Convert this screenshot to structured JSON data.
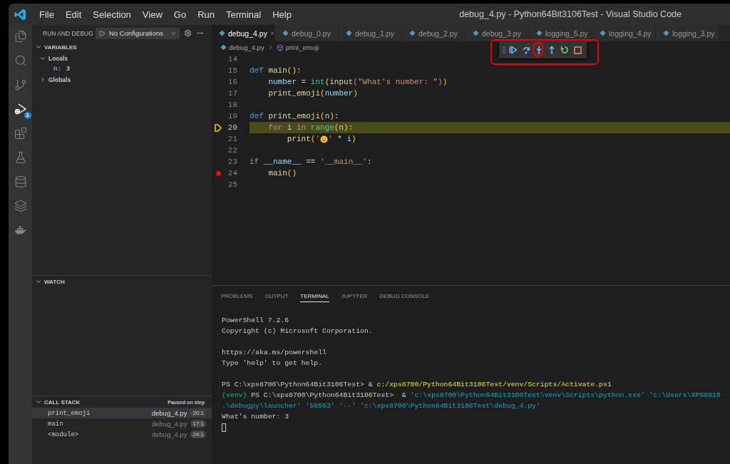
{
  "window": {
    "title": "debug_4.py - Python64Bit3106Test - Visual Studio Code"
  },
  "menu": [
    "File",
    "Edit",
    "Selection",
    "View",
    "Go",
    "Run",
    "Terminal",
    "Help"
  ],
  "activity_bar": [
    {
      "kind": "explorer",
      "selected": false
    },
    {
      "kind": "search",
      "selected": false
    },
    {
      "kind": "source-control",
      "selected": false
    },
    {
      "kind": "run-debug",
      "selected": true,
      "badge": "1"
    },
    {
      "kind": "extensions",
      "selected": false
    },
    {
      "kind": "testing",
      "selected": false
    },
    {
      "kind": "database",
      "selected": false
    },
    {
      "kind": "layers",
      "selected": false
    },
    {
      "kind": "docker",
      "selected": false
    }
  ],
  "sidebar": {
    "title": "RUN AND DEBUG",
    "configuration": "No Configurations",
    "variables": {
      "title": "VARIABLES",
      "expanded": true,
      "scopes": [
        {
          "name": "Locals",
          "expanded": true,
          "children": [
            {
              "name": "n:",
              "value": "3"
            }
          ]
        },
        {
          "name": "Globals",
          "expanded": false
        }
      ]
    },
    "watch": {
      "title": "WATCH",
      "expanded": true
    },
    "call_stack": {
      "title": "CALL STACK",
      "status": "Paused on step",
      "expanded": true,
      "frames": [
        {
          "name": "print_emoji",
          "file": "debug_4.py",
          "position": "20:1",
          "selected": true
        },
        {
          "name": "main",
          "file": "debug_4.py",
          "position": "17:1",
          "selected": false
        },
        {
          "name": "<module>",
          "file": "debug_4.py",
          "position": "24:1",
          "selected": false
        }
      ]
    }
  },
  "tabs": [
    {
      "label": "debug_4.py",
      "selected": true
    },
    {
      "label": "debug_0.py",
      "selected": false
    },
    {
      "label": "debug_1.py",
      "selected": false
    },
    {
      "label": "debug_2.py",
      "selected": false
    },
    {
      "label": "debug_3.py",
      "selected": false
    },
    {
      "label": "logging_5.py",
      "selected": false
    },
    {
      "label": "logging_4.py",
      "selected": false
    },
    {
      "label": "logging_3.py",
      "selected": false
    }
  ],
  "breadcrumb": [
    "debug_4.py",
    "print_emoji"
  ],
  "debug_toolbar": {
    "annotated": true,
    "buttons": [
      {
        "kind": "continue",
        "circled": false
      },
      {
        "kind": "step-over",
        "circled": false
      },
      {
        "kind": "step-into",
        "circled": true
      },
      {
        "kind": "step-out",
        "circled": false
      },
      {
        "kind": "restart",
        "circled": false
      },
      {
        "kind": "stop",
        "circled": false
      }
    ]
  },
  "editor": {
    "lines": [
      {
        "number": "14",
        "current": false,
        "breakpoint": false
      },
      {
        "number": "15",
        "current": false,
        "breakpoint": false,
        "tokens": [
          {
            "text": "def ",
            "kind": "kw"
          },
          {
            "text": "main",
            "kind": "fn"
          },
          {
            "text": "()",
            "kind": "p1"
          },
          {
            "text": ":",
            "kind": "op"
          }
        ]
      },
      {
        "number": "16",
        "current": false,
        "breakpoint": false,
        "tokens": [
          {
            "text": "    number",
            "kind": "var"
          },
          {
            "text": " = ",
            "kind": "op"
          },
          {
            "text": "int",
            "kind": "builtin"
          },
          {
            "text": "(",
            "kind": "p1"
          },
          {
            "text": "input",
            "kind": "fn"
          },
          {
            "text": "(",
            "kind": "p2"
          },
          {
            "text": "\"What's number: \"",
            "kind": "str"
          },
          {
            "text": ")",
            "kind": "p2"
          },
          {
            "text": ")",
            "kind": "p1"
          }
        ]
      },
      {
        "number": "17",
        "current": false,
        "breakpoint": false,
        "tokens": [
          {
            "text": "    print_emoji",
            "kind": "fn"
          },
          {
            "text": "(",
            "kind": "p1"
          },
          {
            "text": "number",
            "kind": "var"
          },
          {
            "text": ")",
            "kind": "p1"
          }
        ]
      },
      {
        "number": "18",
        "current": false,
        "breakpoint": false
      },
      {
        "number": "19",
        "current": false,
        "breakpoint": false,
        "tokens": [
          {
            "text": "def ",
            "kind": "kw"
          },
          {
            "text": "print_emoji",
            "kind": "fn"
          },
          {
            "text": "(",
            "kind": "p1"
          },
          {
            "text": "n",
            "kind": "var"
          },
          {
            "text": ")",
            "kind": "p1"
          },
          {
            "text": ":",
            "kind": "op"
          }
        ]
      },
      {
        "number": "20",
        "current": true,
        "breakpoint": false,
        "tokens": [
          {
            "text": "    for ",
            "kind": "ctrl"
          },
          {
            "text": "i ",
            "kind": "var"
          },
          {
            "text": "in ",
            "kind": "ctrl"
          },
          {
            "text": "range",
            "kind": "builtin"
          },
          {
            "text": "(",
            "kind": "p1"
          },
          {
            "text": "n",
            "kind": "var"
          },
          {
            "text": ")",
            "kind": "p1"
          },
          {
            "text": ":",
            "kind": "op"
          }
        ]
      },
      {
        "number": "21",
        "current": false,
        "breakpoint": false,
        "tokens": [
          {
            "text": "        print",
            "kind": "fn"
          },
          {
            "text": "(",
            "kind": "p1"
          },
          {
            "text": "'",
            "kind": "str"
          },
          {
            "kind": "emoji"
          },
          {
            "text": "'",
            "kind": "str"
          },
          {
            "text": " * ",
            "kind": "op"
          },
          {
            "text": "i",
            "kind": "var"
          },
          {
            "text": ")",
            "kind": "p1"
          }
        ]
      },
      {
        "number": "22",
        "current": false,
        "breakpoint": false
      },
      {
        "number": "23",
        "current": false,
        "breakpoint": false,
        "tokens": [
          {
            "text": "if ",
            "kind": "ctrl"
          },
          {
            "text": "__name__",
            "kind": "var"
          },
          {
            "text": " == ",
            "kind": "op"
          },
          {
            "text": "'__main__'",
            "kind": "str"
          },
          {
            "text": ":",
            "kind": "op"
          }
        ]
      },
      {
        "number": "24",
        "current": false,
        "breakpoint": true,
        "tokens": [
          {
            "text": "    main",
            "kind": "fn"
          },
          {
            "text": "()",
            "kind": "p1"
          }
        ]
      },
      {
        "number": "25",
        "current": false,
        "breakpoint": false
      }
    ]
  },
  "panel": {
    "tabs": [
      {
        "label": "PROBLEMS",
        "selected": false
      },
      {
        "label": "OUTPUT",
        "selected": false
      },
      {
        "label": "TERMINAL",
        "selected": true
      },
      {
        "label": "JUPYTER",
        "selected": false
      },
      {
        "label": "DEBUG CONSOLE",
        "selected": false
      }
    ],
    "terminal": [
      {
        "kind": "text",
        "segments": [
          {
            "text": "PowerShell 7.2.6",
            "kind": "plain"
          }
        ]
      },
      {
        "kind": "text",
        "segments": [
          {
            "text": "Copyright (c) Microsoft Corporation.",
            "kind": "plain"
          }
        ]
      },
      {
        "kind": "blank"
      },
      {
        "kind": "text",
        "segments": [
          {
            "text": "https://aka.ms/powershell",
            "kind": "plain"
          }
        ]
      },
      {
        "kind": "text",
        "segments": [
          {
            "text": "Type 'help' to get help.",
            "kind": "plain"
          }
        ]
      },
      {
        "kind": "blank"
      },
      {
        "kind": "text",
        "segments": [
          {
            "text": "PS C:\\xps8700\\Python64Bit3106Test> & ",
            "kind": "plain"
          },
          {
            "text": "c:/xps8700/Python64Bit3106Test/venv/Scripts/Activate.ps1",
            "kind": "yellow"
          }
        ]
      },
      {
        "kind": "text",
        "segments": [
          {
            "text": "(venv) ",
            "kind": "green"
          },
          {
            "text": "PS C:\\xps8700\\Python64Bit3106Test>  & ",
            "kind": "plain"
          },
          {
            "text": "'c:\\xps8700\\Python64Bit3106Test\\venv\\Scripts\\python.exe' 'c:\\Users\\XPS8910",
            "kind": "cyan"
          }
        ]
      },
      {
        "kind": "text",
        "segments": [
          {
            "text": ".\\debugpy\\launcher' '59563' '--' 'c:\\xps8700\\Python64Bit3106Test\\debug_4.py'",
            "kind": "cyan"
          }
        ]
      },
      {
        "kind": "text",
        "segments": [
          {
            "text": "What's number: 3",
            "kind": "plain"
          }
        ]
      },
      {
        "kind": "cursor"
      }
    ]
  }
}
